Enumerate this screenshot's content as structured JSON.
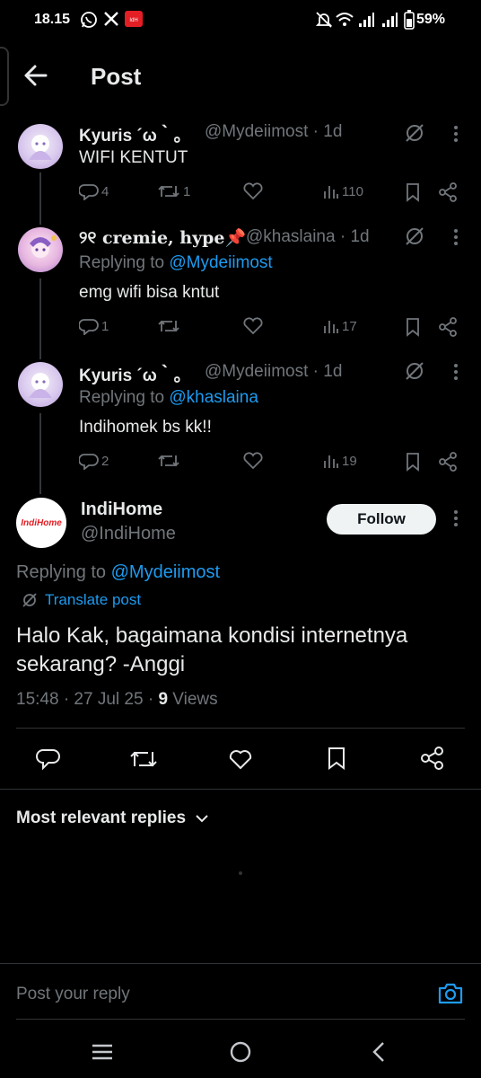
{
  "status_bar": {
    "time": "18.15",
    "battery": "59%"
  },
  "header": {
    "title": "Post"
  },
  "thread": [
    {
      "name": "Kyuris ´ω｀｡",
      "handle": "@Mydeiimost · 1d",
      "replying_prefix": "",
      "replying_to": "",
      "text": "WIFI KENTUT",
      "replies": "4",
      "reposts": "1",
      "views": "110"
    },
    {
      "name": "୨୧ cremie, hype📌",
      "handle": "@khaslaina · 1d",
      "replying_prefix": "Replying to ",
      "replying_to": "@Mydeiimost",
      "text": "emg wifi bisa kntut",
      "replies": "1",
      "reposts": "",
      "views": "17"
    },
    {
      "name": "Kyuris ´ω｀｡",
      "handle": "@Mydeiimost · 1d",
      "replying_prefix": "Replying to ",
      "replying_to": "@khaslaina",
      "text": "Indihomek bs kk!!",
      "replies": "2",
      "reposts": "",
      "views": "19"
    }
  ],
  "main_post": {
    "avatar_text": "IndiHome",
    "name": "IndiHome",
    "handle": "@IndiHome",
    "follow_label": "Follow",
    "replying_prefix": "Replying to ",
    "replying_to": "@Mydeiimost",
    "translate_label": "Translate post",
    "text": "Halo Kak, bagaimana kondisi internetnya sekarang? -Anggi",
    "timestamp": "15:48 · 27 Jul 25 · ",
    "views_count": "9",
    "views_label": " Views"
  },
  "replies_sort": {
    "label": "Most relevant replies"
  },
  "reply_box": {
    "placeholder": "Post your reply"
  },
  "colors": {
    "background": "#000000",
    "accent": "#1d9bf0",
    "muted": "#71767b",
    "text": "#e7e9ea"
  },
  "icons": [
    "back-arrow-icon",
    "grok-icon",
    "more-icon",
    "reply-icon",
    "repost-icon",
    "like-icon",
    "views-icon",
    "bookmark-icon",
    "share-icon",
    "translate-icon",
    "chevron-down-icon",
    "camera-icon",
    "recents-icon",
    "home-icon",
    "back-icon"
  ]
}
